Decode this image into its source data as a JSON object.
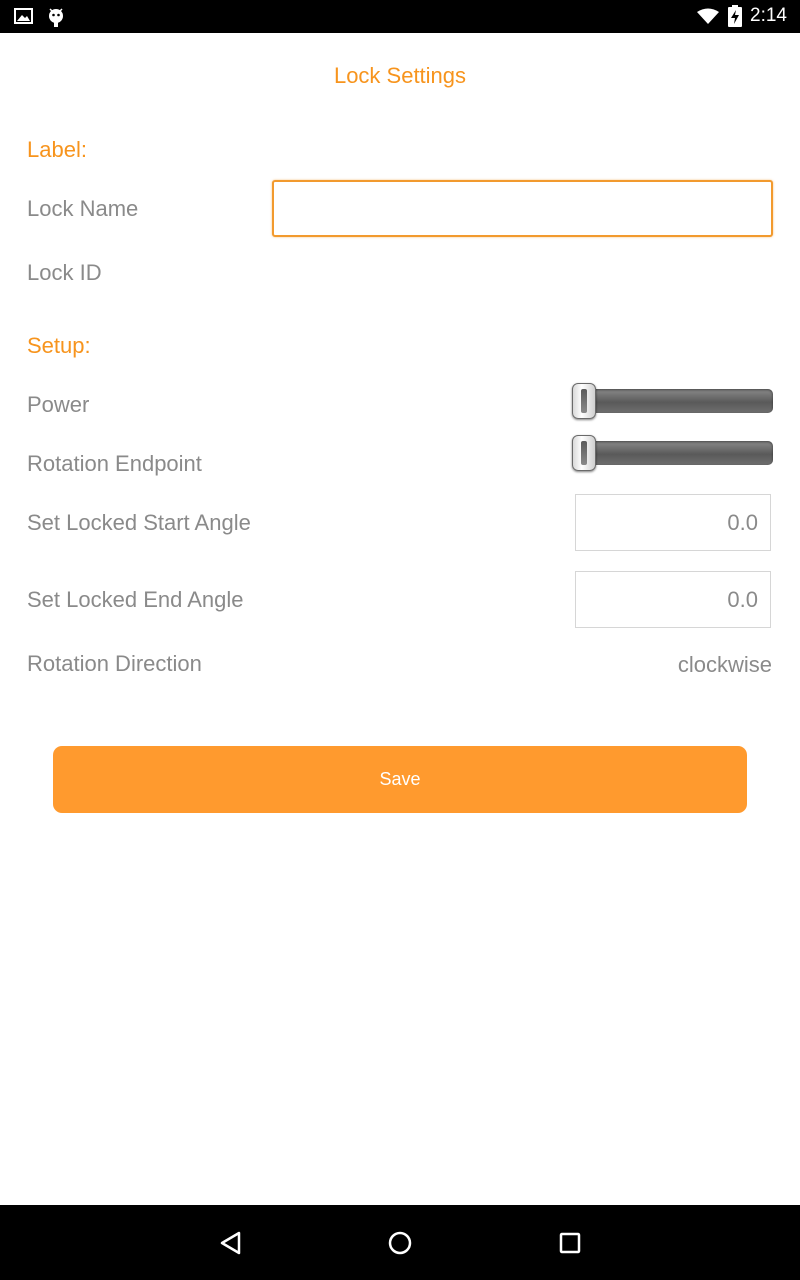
{
  "status_bar": {
    "time": "2:14",
    "icons": [
      "image-icon",
      "android-debug-icon",
      "wifi-icon",
      "battery-charging-icon"
    ]
  },
  "page": {
    "title": "Lock Settings"
  },
  "label_section": {
    "heading": "Label:",
    "lock_name_label": "Lock Name",
    "lock_name_value": "",
    "lock_id_label": "Lock ID"
  },
  "setup_section": {
    "heading": "Setup:",
    "power_label": "Power",
    "power_level": 0,
    "rotation_endpoint_label": "Rotation Endpoint",
    "rotation_endpoint_level": 0,
    "start_angle_label": "Set Locked Start Angle",
    "start_angle_value": "0.0",
    "end_angle_label": "Set Locked End Angle",
    "end_angle_value": "0.0",
    "rotation_direction_label": "Rotation Direction",
    "rotation_direction_value": "clockwise"
  },
  "actions": {
    "save_label": "Save"
  },
  "nav_bar": {
    "icons": [
      "back-icon",
      "home-icon",
      "recent-apps-icon"
    ]
  },
  "colors": {
    "accent": "#f7941d",
    "button": "#ff9a2e",
    "label_gray": "#8a8a8a"
  }
}
